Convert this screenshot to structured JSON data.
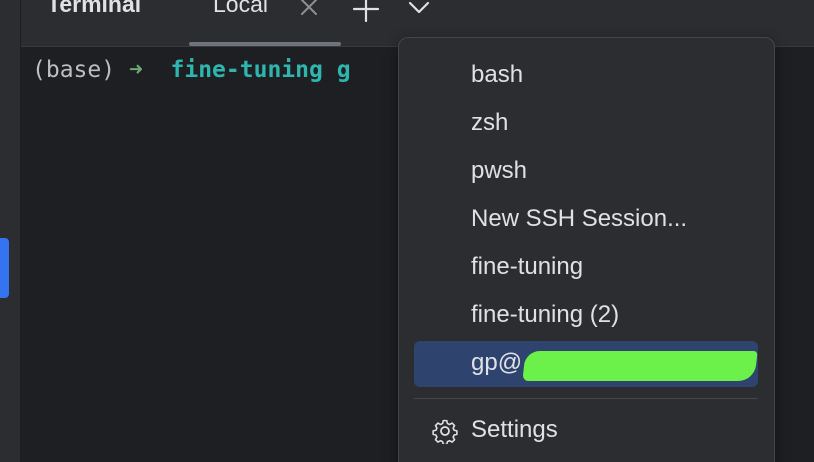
{
  "toolwindow": {
    "title": "Terminal"
  },
  "tabs": [
    {
      "label": "Local"
    }
  ],
  "terminal": {
    "prompt_env": "(base)",
    "prompt_arrow": "➜",
    "prompt_dir": "fine-tuning",
    "prompt_rest": "g"
  },
  "menu": {
    "items": [
      {
        "label": "bash"
      },
      {
        "label": "zsh"
      },
      {
        "label": "pwsh"
      },
      {
        "label": "New SSH Session..."
      },
      {
        "label": "fine-tuning"
      },
      {
        "label": "fine-tuning (2)"
      },
      {
        "label": "gp@",
        "selected": true,
        "redacted": true
      }
    ],
    "settings_label": "Settings"
  },
  "icons": {
    "tab_close": "close-icon",
    "new_tab": "plus-icon",
    "dropdown": "chevron-down-icon",
    "settings": "gear-icon"
  },
  "colors": {
    "accent": "#3574f0",
    "selection": "#2e436e",
    "prompt_arrow": "#6aab73",
    "prompt_dir": "#2fb5b0",
    "redaction": "#6cf04a"
  }
}
